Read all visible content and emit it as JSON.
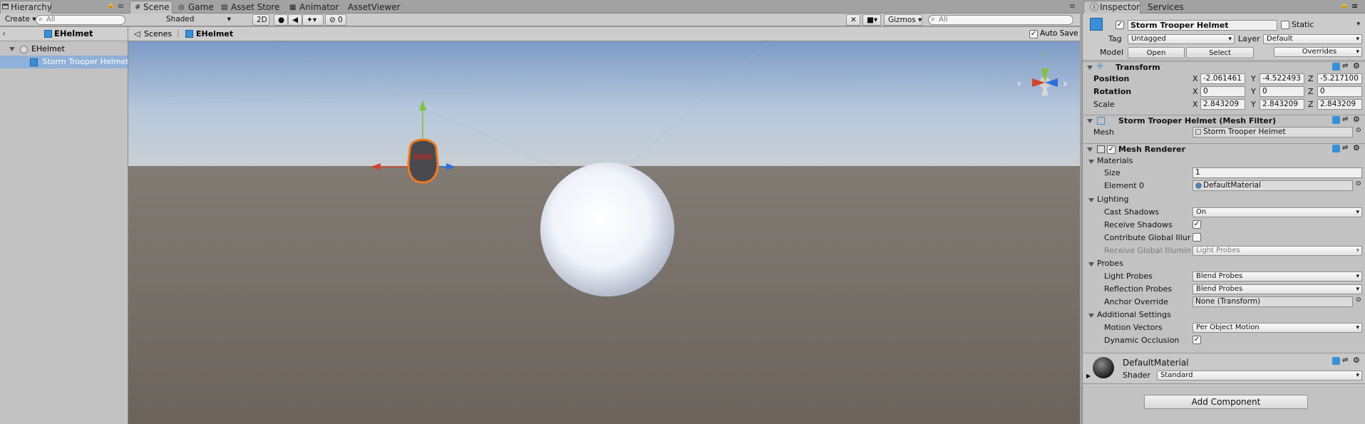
{
  "hierarchy": {
    "tab": "Hierarchy",
    "create": "Create",
    "search_placeholder": "All",
    "scene_name": "EHelmet",
    "root": "EHelmet",
    "child": "Storm Trooper Helmet"
  },
  "scene": {
    "tabs": [
      "Scene",
      "Game",
      "Asset Store",
      "Animator",
      "AssetViewer"
    ],
    "shading": "Shaded",
    "mode_2d": "2D",
    "fx_count": "0",
    "gizmos": "Gizmos",
    "search_placeholder": "All",
    "breadcrumb_scenes": "Scenes",
    "breadcrumb_prefab": "EHelmet",
    "auto_save": "Auto Save",
    "gizmo_x": "x",
    "gizmo_y": "y",
    "gizmo_z": "z"
  },
  "inspector": {
    "tabs": [
      "Inspector",
      "Services"
    ],
    "object_name": "Storm Trooper Helmet",
    "static_label": "Static",
    "tag_label": "Tag",
    "tag_value": "Untagged",
    "layer_label": "Layer",
    "layer_value": "Default",
    "model_label": "Model",
    "open": "Open",
    "select": "Select",
    "overrides": "Overrides",
    "transform": {
      "title": "Transform",
      "position": "Position",
      "rotation": "Rotation",
      "scale": "Scale",
      "pos": [
        "-2.061461",
        "-4.522493",
        "-5.217100"
      ],
      "rot": [
        "0",
        "0",
        "0"
      ],
      "scl": [
        "2.843209",
        "2.843209",
        "2.843209"
      ],
      "x": "X",
      "y": "Y",
      "z": "Z"
    },
    "mesh_filter": {
      "title": "Storm Trooper Helmet (Mesh Filter)",
      "mesh_label": "Mesh",
      "mesh_value": "Storm Trooper Helmet"
    },
    "mesh_renderer": {
      "title": "Mesh Renderer",
      "materials": "Materials",
      "size_label": "Size",
      "size_value": "1",
      "element0_label": "Element 0",
      "element0_value": "DefaultMaterial",
      "lighting": "Lighting",
      "cast_shadows": "Cast Shadows",
      "cast_value": "On",
      "receive_shadows": "Receive Shadows",
      "contribute_gi": "Contribute Global Illur",
      "receive_gi": "Receive Global Illumin",
      "receive_gi_value": "Light Probes",
      "probes": "Probes",
      "light_probes": "Light Probes",
      "light_probes_value": "Blend Probes",
      "reflection_probes": "Reflection Probes",
      "reflection_value": "Blend Probes",
      "anchor_override": "Anchor Override",
      "anchor_value": "None (Transform)",
      "additional": "Additional Settings",
      "motion_vectors": "Motion Vectors",
      "motion_value": "Per Object Motion",
      "dynamic_occlusion": "Dynamic Occlusion"
    },
    "material": {
      "name": "DefaultMaterial",
      "shader_label": "Shader",
      "shader_value": "Standard"
    },
    "add_component": "Add Component"
  }
}
